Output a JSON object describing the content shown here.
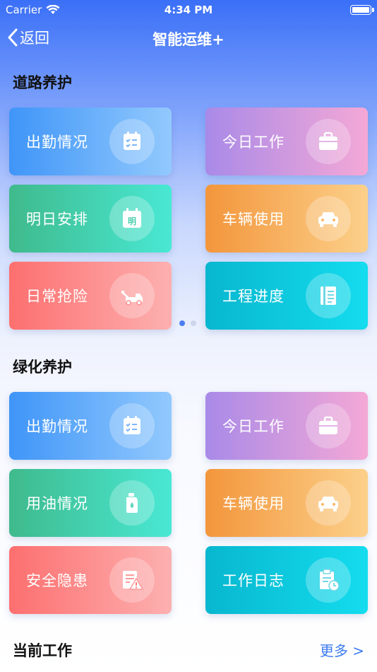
{
  "status_bar": {
    "carrier": "Carrier",
    "time": "4:34 PM"
  },
  "nav": {
    "back_label": "返回",
    "title": "智能运维+"
  },
  "sections": [
    {
      "title": "道路养护",
      "cards": [
        {
          "label": "出勤情况",
          "icon": "attendance-icon"
        },
        {
          "label": "今日工作",
          "icon": "briefcase-icon"
        },
        {
          "label": "明日安排",
          "icon": "calendar-icon",
          "icon_text": "明"
        },
        {
          "label": "车辆使用",
          "icon": "car-icon"
        },
        {
          "label": "日常抢险",
          "icon": "tow-truck-icon"
        },
        {
          "label": "工程进度",
          "icon": "document-icon"
        }
      ],
      "pager": {
        "pages": 2,
        "active": 1
      }
    },
    {
      "title": "绿化养护",
      "cards": [
        {
          "label": "出勤情况",
          "icon": "attendance-icon"
        },
        {
          "label": "今日工作",
          "icon": "briefcase-icon"
        },
        {
          "label": "用油情况",
          "icon": "fuel-bottle-icon"
        },
        {
          "label": "车辆使用",
          "icon": "car-icon"
        },
        {
          "label": "安全隐患",
          "icon": "warning-document-icon"
        },
        {
          "label": "工作日志",
          "icon": "clipboard-clock-icon"
        }
      ]
    },
    {
      "title": "当前工作",
      "more_label": "更多 >"
    }
  ],
  "colors": {
    "blue": [
      "#3f95f8",
      "#92c9fd"
    ],
    "purple": [
      "#a98ae8",
      "#f4a8d6"
    ],
    "green": [
      "#3fba8c",
      "#49e8d4"
    ],
    "orange": [
      "#f3963c",
      "#fcd08a"
    ],
    "red": [
      "#fd6f6f",
      "#fdb0b0"
    ],
    "cyan": [
      "#08b7cf",
      "#14dcee"
    ],
    "accent": "#3d7cf0"
  }
}
